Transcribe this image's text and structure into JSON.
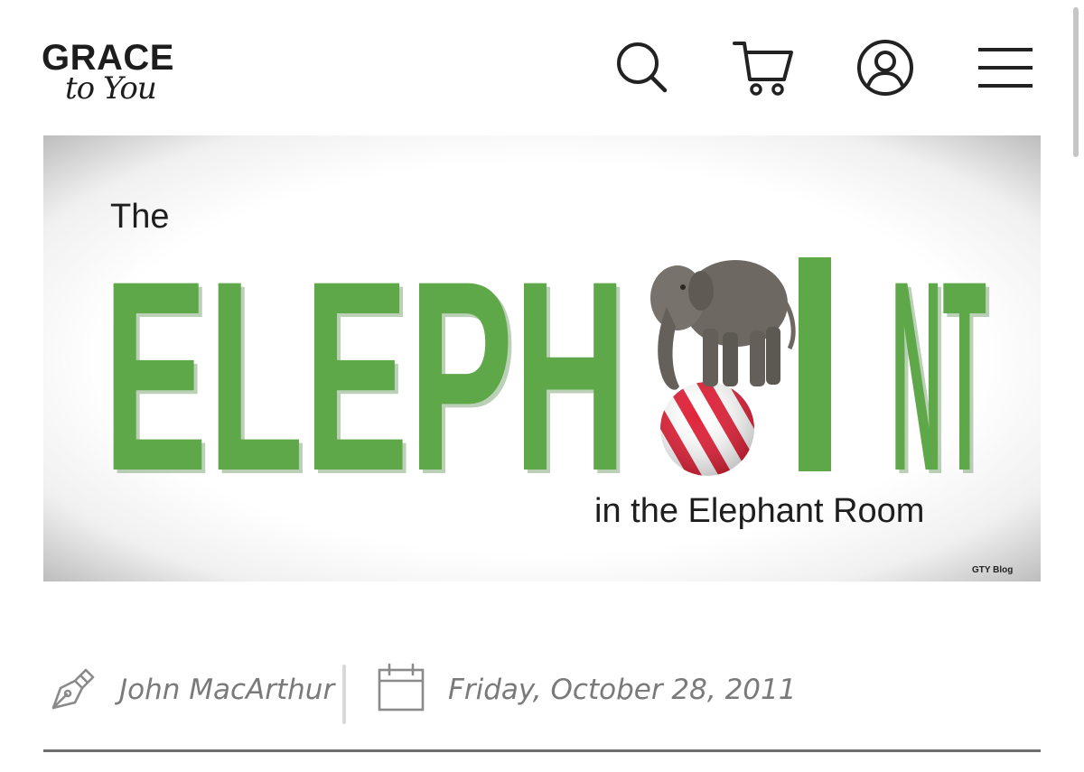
{
  "header": {
    "logo": {
      "line1": "GRACE",
      "line2": "to You"
    },
    "icons": [
      "search-icon",
      "cart-icon",
      "account-icon",
      "menu-icon"
    ]
  },
  "hero": {
    "text_top": "The",
    "text_main": "ELEPH",
    "text_main_end": "NT",
    "text_bottom": "in the Elephant Room",
    "watermark": "GTY Blog",
    "colors": {
      "green": "#5fa84a",
      "ball_red": "#e0243a",
      "elephant": "#6d6862"
    }
  },
  "meta": {
    "author": "John MacArthur",
    "date": "Friday, October 28, 2011",
    "icons": [
      "pen-icon",
      "calendar-icon"
    ]
  }
}
